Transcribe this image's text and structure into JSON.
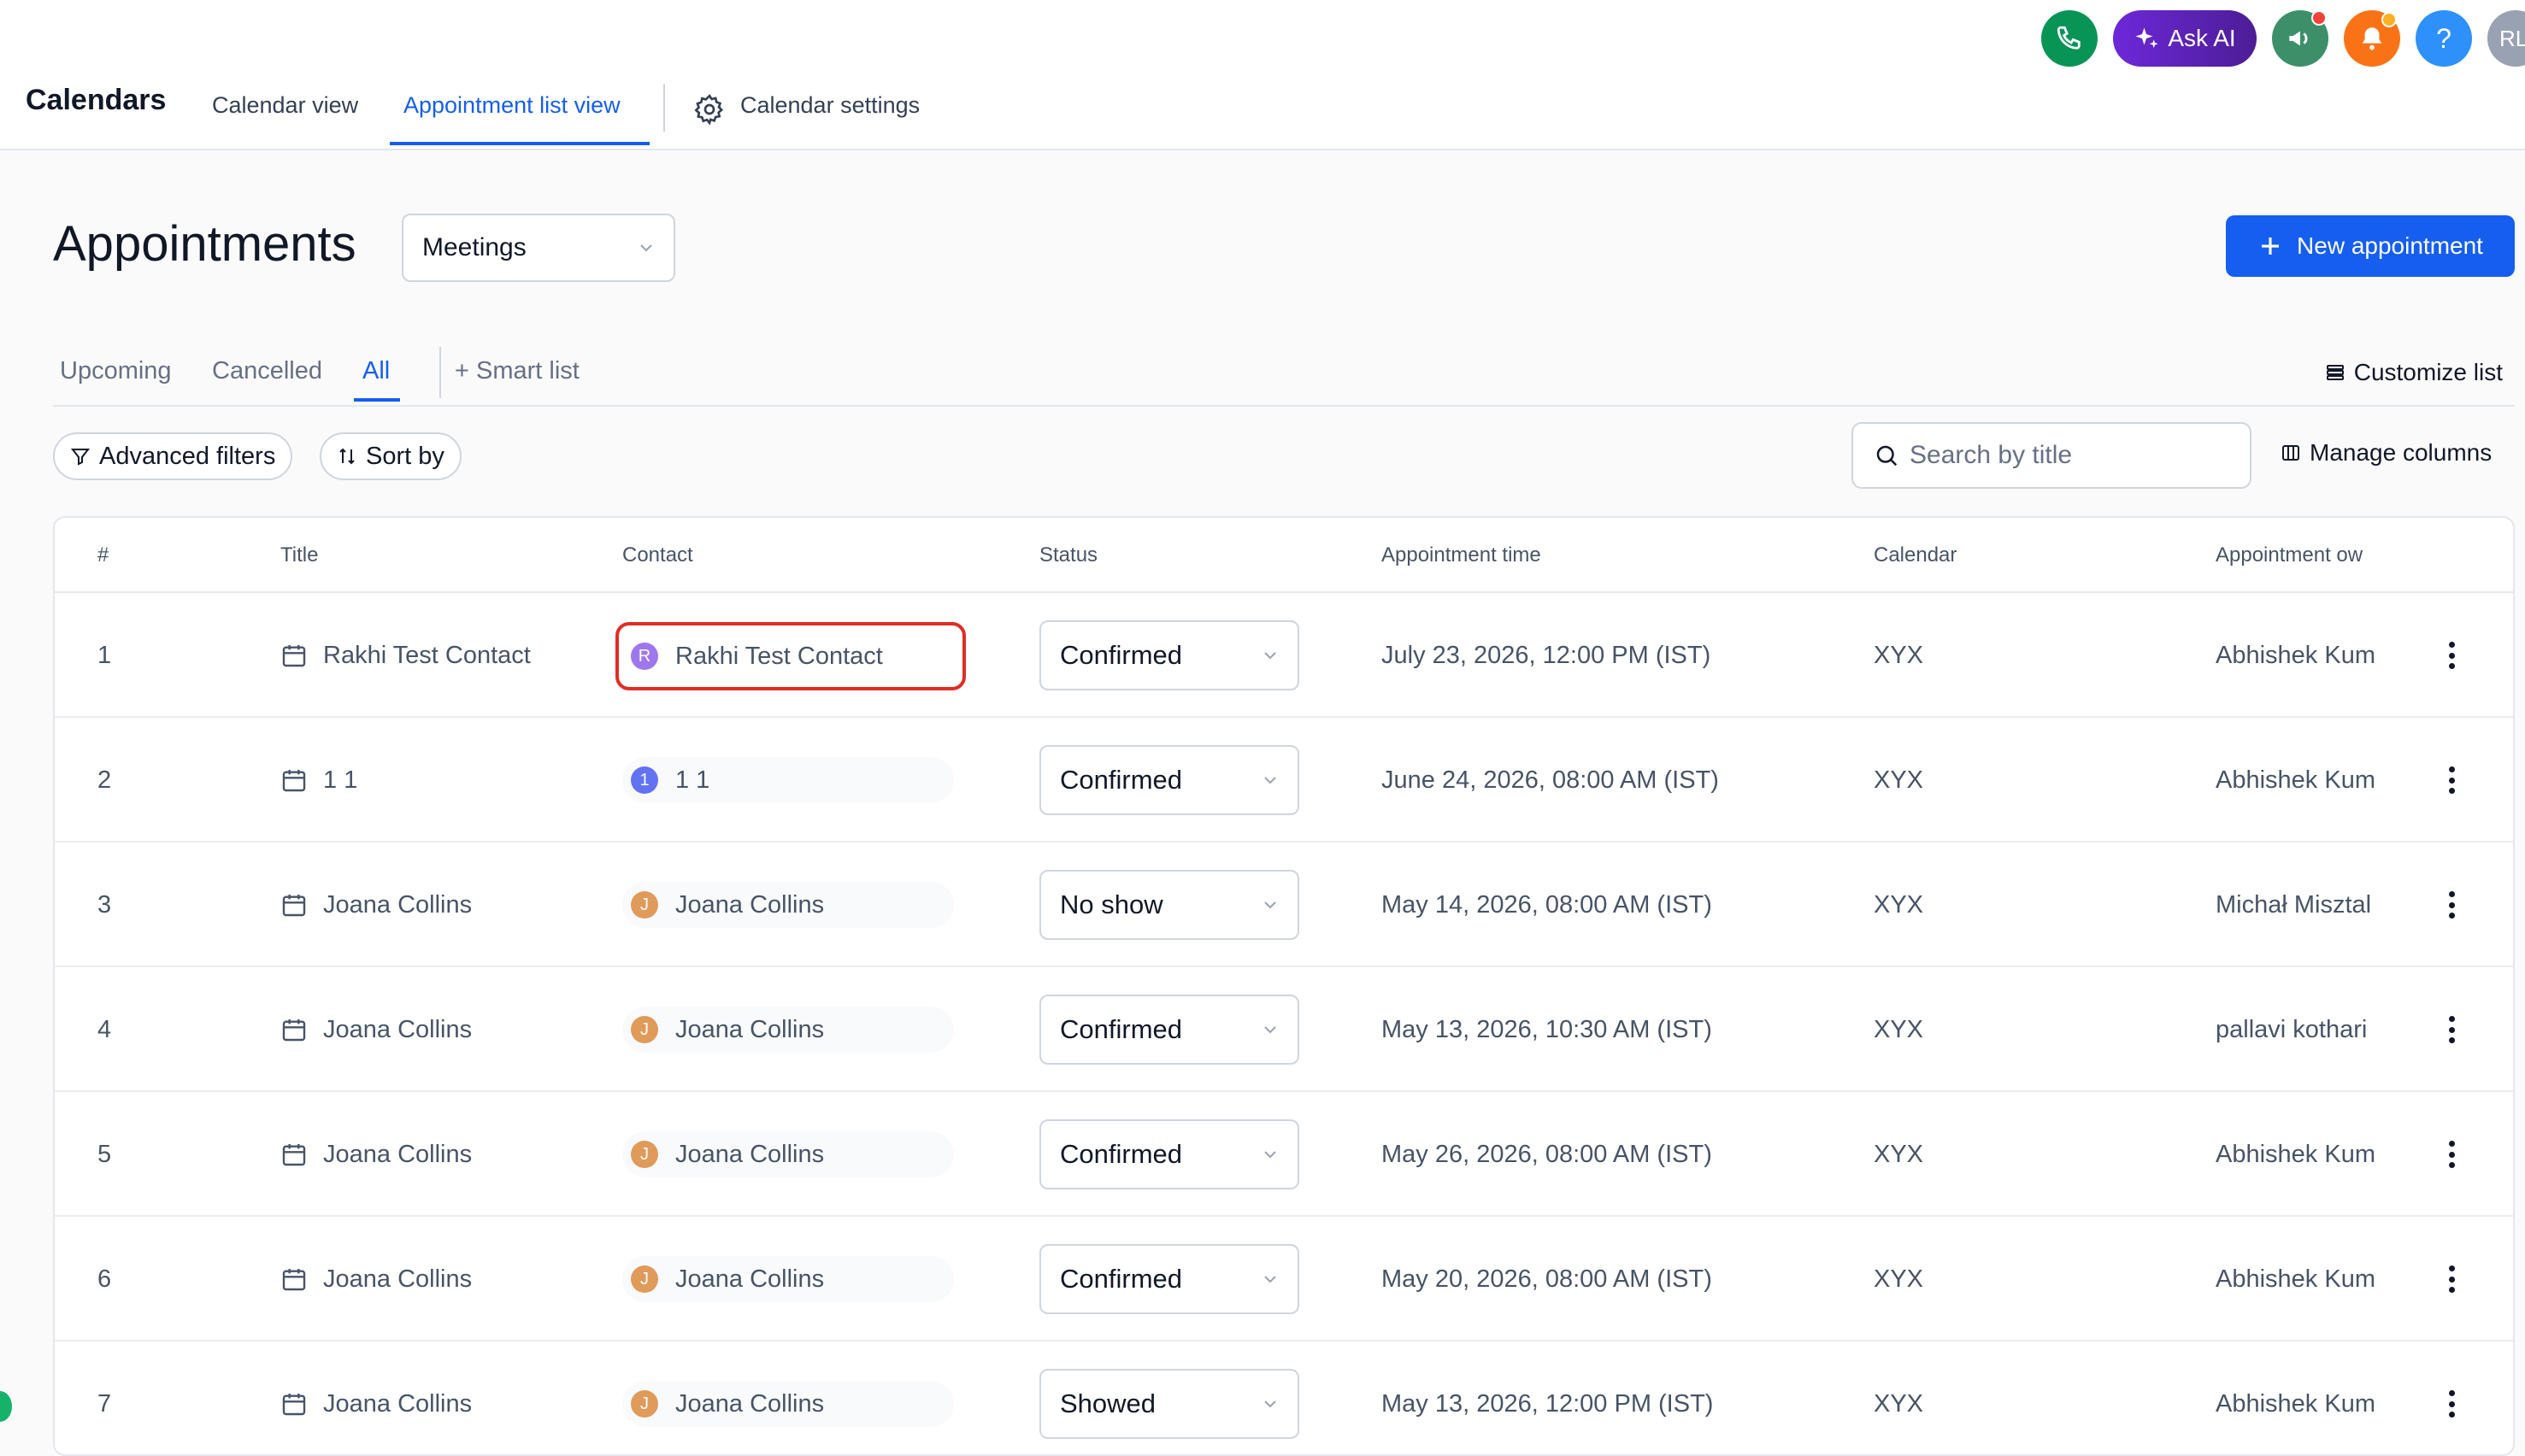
{
  "header": {
    "brand": "Calendars",
    "tabs": [
      {
        "label": "Calendar view",
        "active": false
      },
      {
        "label": "Appointment list view",
        "active": true
      },
      {
        "label": "Calendar settings",
        "active": false
      }
    ],
    "ask_ai_label": "Ask AI",
    "help_label": "?",
    "user_initials": "RL"
  },
  "page": {
    "title": "Appointments",
    "calendar_filter": "Meetings",
    "new_button": "New appointment"
  },
  "subtabs": {
    "items": [
      {
        "label": "Upcoming",
        "active": false
      },
      {
        "label": "Cancelled",
        "active": false
      },
      {
        "label": "All",
        "active": true
      }
    ],
    "smart_list": "+ Smart list",
    "customize": "Customize list"
  },
  "toolbar": {
    "advanced_filters": "Advanced filters",
    "sort_by": "Sort by",
    "search_placeholder": "Search by title",
    "manage_columns": "Manage columns"
  },
  "table": {
    "columns": [
      "#",
      "Title",
      "Contact",
      "Status",
      "Appointment time",
      "Calendar",
      "Appointment ow"
    ],
    "rows": [
      {
        "num": "1",
        "title": "Rakhi Test Contact",
        "contact": "Rakhi Test Contact",
        "initial": "R",
        "avatar_color": "#9e77ed",
        "status": "Confirmed",
        "time": "July 23, 2026, 12:00 PM (IST)",
        "calendar": "XYX",
        "owner": "Abhishek Kum",
        "highlight": true
      },
      {
        "num": "2",
        "title": "1 1",
        "contact": "1 1",
        "initial": "1",
        "avatar_color": "#6172f3",
        "status": "Confirmed",
        "time": "June 24, 2026, 08:00 AM (IST)",
        "calendar": "XYX",
        "owner": "Abhishek Kum",
        "highlight": false
      },
      {
        "num": "3",
        "title": "Joana Collins",
        "contact": "Joana Collins",
        "initial": "J",
        "avatar_color": "#e09a5a",
        "status": "No show",
        "time": "May 14, 2026, 08:00 AM (IST)",
        "calendar": "XYX",
        "owner": "Michał Misztal",
        "highlight": false
      },
      {
        "num": "4",
        "title": "Joana Collins",
        "contact": "Joana Collins",
        "initial": "J",
        "avatar_color": "#e09a5a",
        "status": "Confirmed",
        "time": "May 13, 2026, 10:30 AM (IST)",
        "calendar": "XYX",
        "owner": "pallavi kothari",
        "highlight": false
      },
      {
        "num": "5",
        "title": "Joana Collins",
        "contact": "Joana Collins",
        "initial": "J",
        "avatar_color": "#e09a5a",
        "status": "Confirmed",
        "time": "May 26, 2026, 08:00 AM (IST)",
        "calendar": "XYX",
        "owner": "Abhishek Kum",
        "highlight": false
      },
      {
        "num": "6",
        "title": "Joana Collins",
        "contact": "Joana Collins",
        "initial": "J",
        "avatar_color": "#e09a5a",
        "status": "Confirmed",
        "time": "May 20, 2026, 08:00 AM (IST)",
        "calendar": "XYX",
        "owner": "Abhishek Kum",
        "highlight": false
      },
      {
        "num": "7",
        "title": "Joana Collins",
        "contact": "Joana Collins",
        "initial": "J",
        "avatar_color": "#e09a5a",
        "status": "Showed",
        "time": "May 13, 2026, 12:00 PM (IST)",
        "calendar": "XYX",
        "owner": "Abhishek Kum",
        "highlight": false
      }
    ]
  },
  "colors": {
    "accent": "#155eef",
    "ask_ai": "#5b21b6",
    "phone": "#079455",
    "notifications": "#f97316",
    "help": "#2e90fa",
    "highlight_border": "#e02d24"
  },
  "icons": [
    "phone-icon",
    "sparkle-icon",
    "megaphone-icon",
    "bell-icon",
    "gear-icon",
    "plus-icon",
    "filter-icon",
    "sort-icon",
    "search-icon",
    "columns-icon",
    "customize-icon",
    "calendar-icon",
    "chevron-down-icon",
    "kebab-menu-icon"
  ]
}
